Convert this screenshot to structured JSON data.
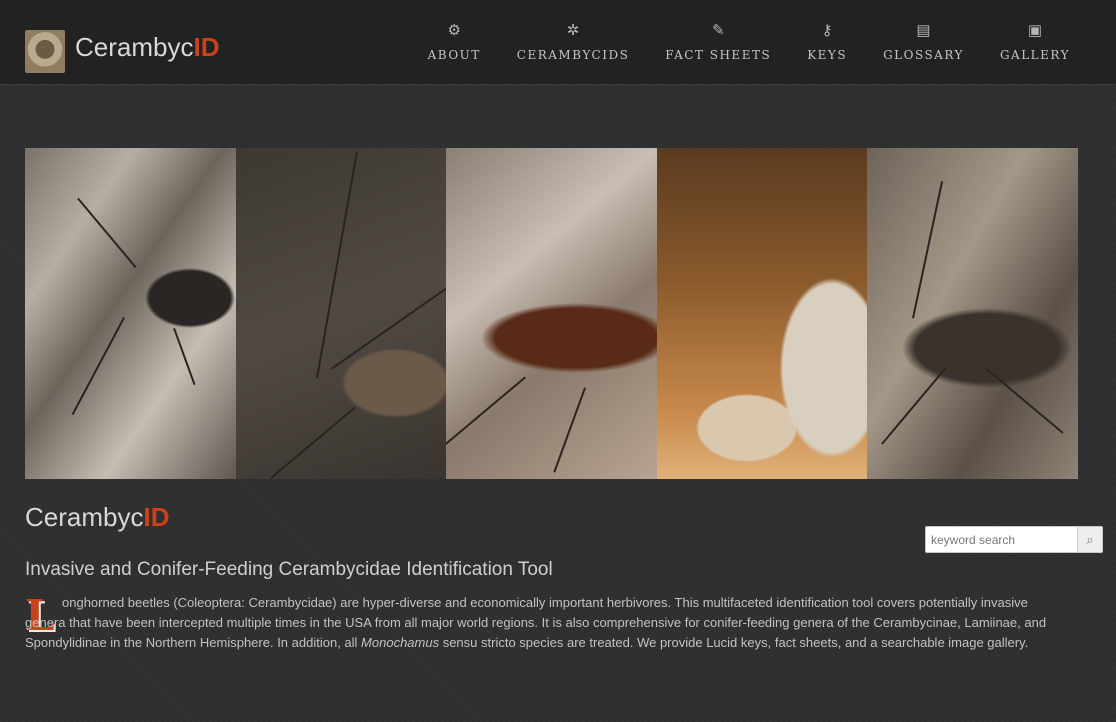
{
  "header": {
    "brand_prefix": "Cerambyc",
    "brand_suffix": "ID",
    "nav": [
      {
        "label": "ABOUT",
        "icon": "gears-icon",
        "glyph": "⚙"
      },
      {
        "label": "CERAMBYCIDS",
        "icon": "beetle-icon",
        "glyph": "✲"
      },
      {
        "label": "FACT SHEETS",
        "icon": "pencil-icon",
        "glyph": "✎"
      },
      {
        "label": "KEYS",
        "icon": "key-icon",
        "glyph": "⚷"
      },
      {
        "label": "GLOSSARY",
        "icon": "book-icon",
        "glyph": "▤"
      },
      {
        "label": "GALLERY",
        "icon": "image-icon",
        "glyph": "▣"
      }
    ]
  },
  "main": {
    "title_prefix": "Cerambyc",
    "title_suffix": "ID",
    "subtitle": "Invasive and Conifer-Feeding Cerambycidae Identification Tool",
    "dropcap": "L",
    "intro_part1": "onghorned beetles (Coleoptera: Cerambycidae) are hyper-diverse and economically important herbivores. This multifaceted identification tool covers potentially invasive genera that have been intercepted multiple times in the USA from all major world regions. It is also comprehensive for conifer-feeding genera of the Cerambycinae, Lamiinae, and Spondylidinae in the Northern Hemisphere. In addition, all ",
    "intro_italic": "Monochamus",
    "intro_part2": " sensu stricto species are treated. We provide Lucid keys, fact sheets, and a searchable image gallery."
  },
  "search": {
    "placeholder": "keyword search",
    "value": ""
  },
  "colors": {
    "accent": "#c8421c",
    "background": "#2f2f2f",
    "header": "#222222"
  }
}
